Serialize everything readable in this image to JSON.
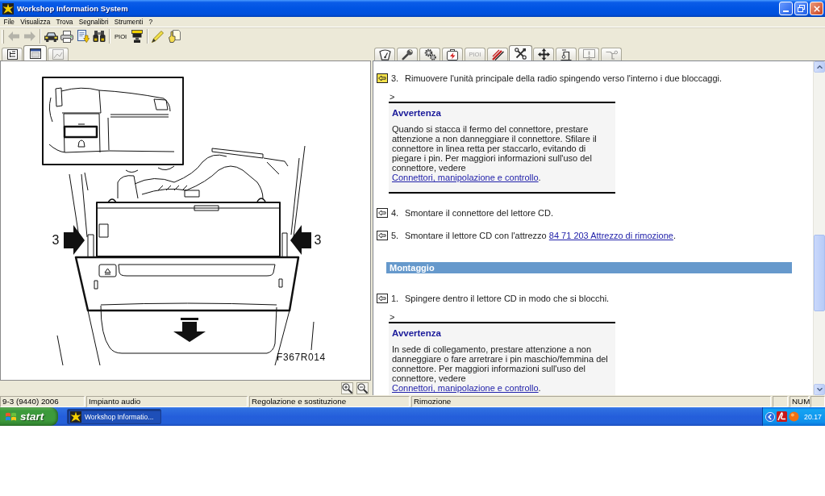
{
  "window": {
    "title": "Workshop Information System"
  },
  "menu": [
    "File",
    "Visualizza",
    "Trova",
    "Segnalibri",
    "Strumenti",
    "?"
  ],
  "toolbar": {
    "groups": [
      [
        {
          "kind": "icon",
          "disabled": true
        },
        {
          "kind": "icon",
          "disabled": true
        }
      ],
      [
        {
          "kind": "icon",
          "disabled": false
        },
        {
          "kind": "icon",
          "disabled": false
        },
        {
          "kind": "icon",
          "disabled": false
        },
        {
          "kind": "icon",
          "disabled": false
        }
      ],
      [
        {
          "kind": "text",
          "label": "PIOI",
          "disabled": false
        },
        {
          "kind": "icon",
          "disabled": false
        }
      ],
      [
        {
          "kind": "icon",
          "disabled": false
        },
        {
          "kind": "icon",
          "disabled": false
        }
      ]
    ]
  },
  "left_pane": {
    "tabs": [
      {
        "kind": "icon",
        "selected": false,
        "disabled": false
      },
      {
        "kind": "icon",
        "selected": true,
        "disabled": false
      },
      {
        "kind": "icon",
        "selected": false,
        "disabled": true
      }
    ],
    "figure": {
      "callouts": [
        "3",
        "3"
      ],
      "code": "F367R014"
    }
  },
  "right_pane": {
    "tabs": [
      {
        "kind": "icon",
        "selected": false,
        "disabled": false
      },
      {
        "kind": "icon",
        "selected": false,
        "disabled": false
      },
      {
        "kind": "icon",
        "selected": false,
        "disabled": false
      },
      {
        "kind": "icon",
        "selected": false,
        "disabled": false
      },
      {
        "kind": "text",
        "label": "PIOI",
        "selected": false,
        "disabled": true
      },
      {
        "kind": "icon",
        "selected": false,
        "disabled": false
      },
      {
        "kind": "icon",
        "selected": true,
        "disabled": false
      },
      {
        "kind": "icon",
        "selected": false,
        "disabled": false
      },
      {
        "kind": "icon",
        "selected": false,
        "disabled": false
      },
      {
        "kind": "icon",
        "selected": false,
        "disabled": true
      },
      {
        "kind": "icon",
        "selected": false,
        "disabled": true
      }
    ],
    "blocks": [
      {
        "kind": "step",
        "selected": true,
        "number": "3.",
        "text": "Rimuovere l'unità principale della radio spingendo verso l'interno i due bloccaggi."
      },
      {
        "kind": "warning",
        "marker": ">",
        "title": "Avvertenza",
        "text": "Quando si stacca il fermo del connettore, prestare attenzione a non danneggiare il connettore. Sfilare il connettore in linea retta per staccarlo, evitando di piegare i pin. Per maggiori informazioni sull'uso del connettore, vedere",
        "link": "Connettori, manipolazione e controllo",
        "after": "."
      },
      {
        "kind": "step",
        "selected": false,
        "number": "4.",
        "text": "Smontare il connettore del lettore CD."
      },
      {
        "kind": "step",
        "selected": false,
        "number": "5.",
        "text": "Smontare il lettore CD con l'attrezzo",
        "link": "84 71 203 Attrezzo di rimozione",
        "after": "."
      },
      {
        "kind": "section",
        "title": "Montaggio"
      },
      {
        "kind": "step",
        "selected": false,
        "number": "1.",
        "text": "Spingere dentro il lettore CD in modo che si blocchi."
      },
      {
        "kind": "warning",
        "marker": ">",
        "title": "Avvertenza",
        "text": "In sede di collegamento, prestare attenzione a non danneggiare o fare arretrare i pin maschio/femmina del connettore. Per maggiori informazioni sull'uso del connettore, vedere",
        "link": "Connettori, manipolazione e controllo",
        "after": "."
      }
    ]
  },
  "status_bar": {
    "panes": [
      "9-3 (9440) 2006",
      "Impianto audio",
      "Regolazione e sostituzione",
      "Rimozione"
    ],
    "indicator": "NUM"
  },
  "taskbar": {
    "start": "start",
    "tasks": [
      {
        "label": "Workshop Informatio...",
        "active": true
      }
    ],
    "clock": "20.17"
  }
}
